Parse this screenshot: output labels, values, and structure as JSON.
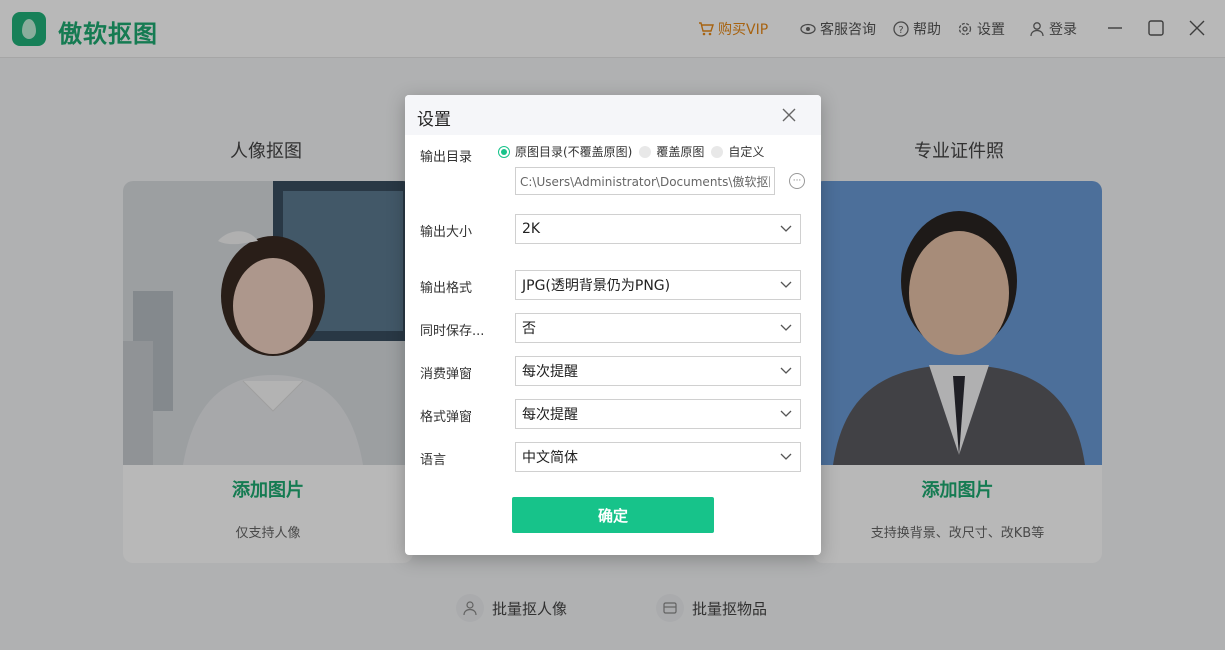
{
  "app": {
    "name": "傲软抠图"
  },
  "topbar": {
    "buy_vip": "购买VIP",
    "support": "客服咨询",
    "help": "帮助",
    "settings": "设置",
    "login": "登录"
  },
  "main": {
    "left": {
      "title": "人像抠图",
      "add": "添加图片",
      "sub": "仅支持人像"
    },
    "right": {
      "title": "专业证件照",
      "add": "添加图片",
      "sub": "支持换背景、改尺寸、改KB等"
    },
    "batch_portrait": "批量抠人像",
    "batch_objects": "批量抠物品"
  },
  "dialog": {
    "title": "设置",
    "output_dir": {
      "label": "输出目录",
      "options": [
        "原图目录(不覆盖原图)",
        "覆盖原图",
        "自定义"
      ],
      "path": "C:\\Users\\Administrator\\Documents\\傲软抠图",
      "more": "···"
    },
    "output_size": {
      "label": "输出大小",
      "value": "2K"
    },
    "output_format": {
      "label": "输出格式",
      "value": "JPG(透明背景仍为PNG)"
    },
    "also_save": {
      "label": "同时保存...",
      "value": "否"
    },
    "consume_popup": {
      "label": "消费弹窗",
      "value": "每次提醒"
    },
    "format_popup": {
      "label": "格式弹窗",
      "value": "每次提醒"
    },
    "language": {
      "label": "语言",
      "value": "中文简体"
    },
    "confirm": "确定"
  },
  "colors": {
    "brand": "#1eab72",
    "accent": "#17c38a",
    "vip": "#e88a18",
    "id_photo_bg": "#6a9ad6"
  }
}
